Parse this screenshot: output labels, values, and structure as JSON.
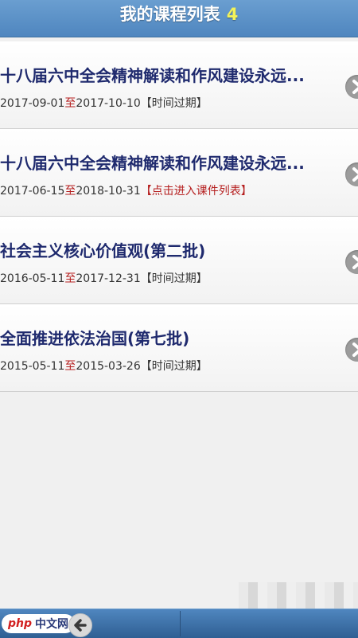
{
  "header": {
    "title": "我的课程列表",
    "count": "4"
  },
  "courses": [
    {
      "title": "十八届六中全会精神解读和作风建设永远...",
      "start": "2017-09-01",
      "sep": "至",
      "end": "2017-10-10",
      "status": "【时间过期】",
      "status_link": false
    },
    {
      "title": "十八届六中全会精神解读和作风建设永远...",
      "start": "2017-06-15",
      "sep": "至",
      "end": "2018-10-31",
      "status": "【点击进入课件列表】",
      "status_link": true
    },
    {
      "title": "社会主义核心价值观(第二批)",
      "start": "2016-05-11",
      "sep": "至",
      "end": "2017-12-31",
      "status": "【时间过期】",
      "status_link": false
    },
    {
      "title": "全面推进依法治国(第七批)",
      "start": "2015-05-11",
      "sep": "至",
      "end": "2015-03-26",
      "status": "【时间过期】",
      "status_link": false
    }
  ],
  "footer": {
    "logo_php": "php",
    "logo_text": "中文网",
    "back_icon": "back-arrow-icon"
  },
  "colors": {
    "header": "#4f86bf",
    "title": "#1f2a6e",
    "highlight": "#b51e1e"
  }
}
